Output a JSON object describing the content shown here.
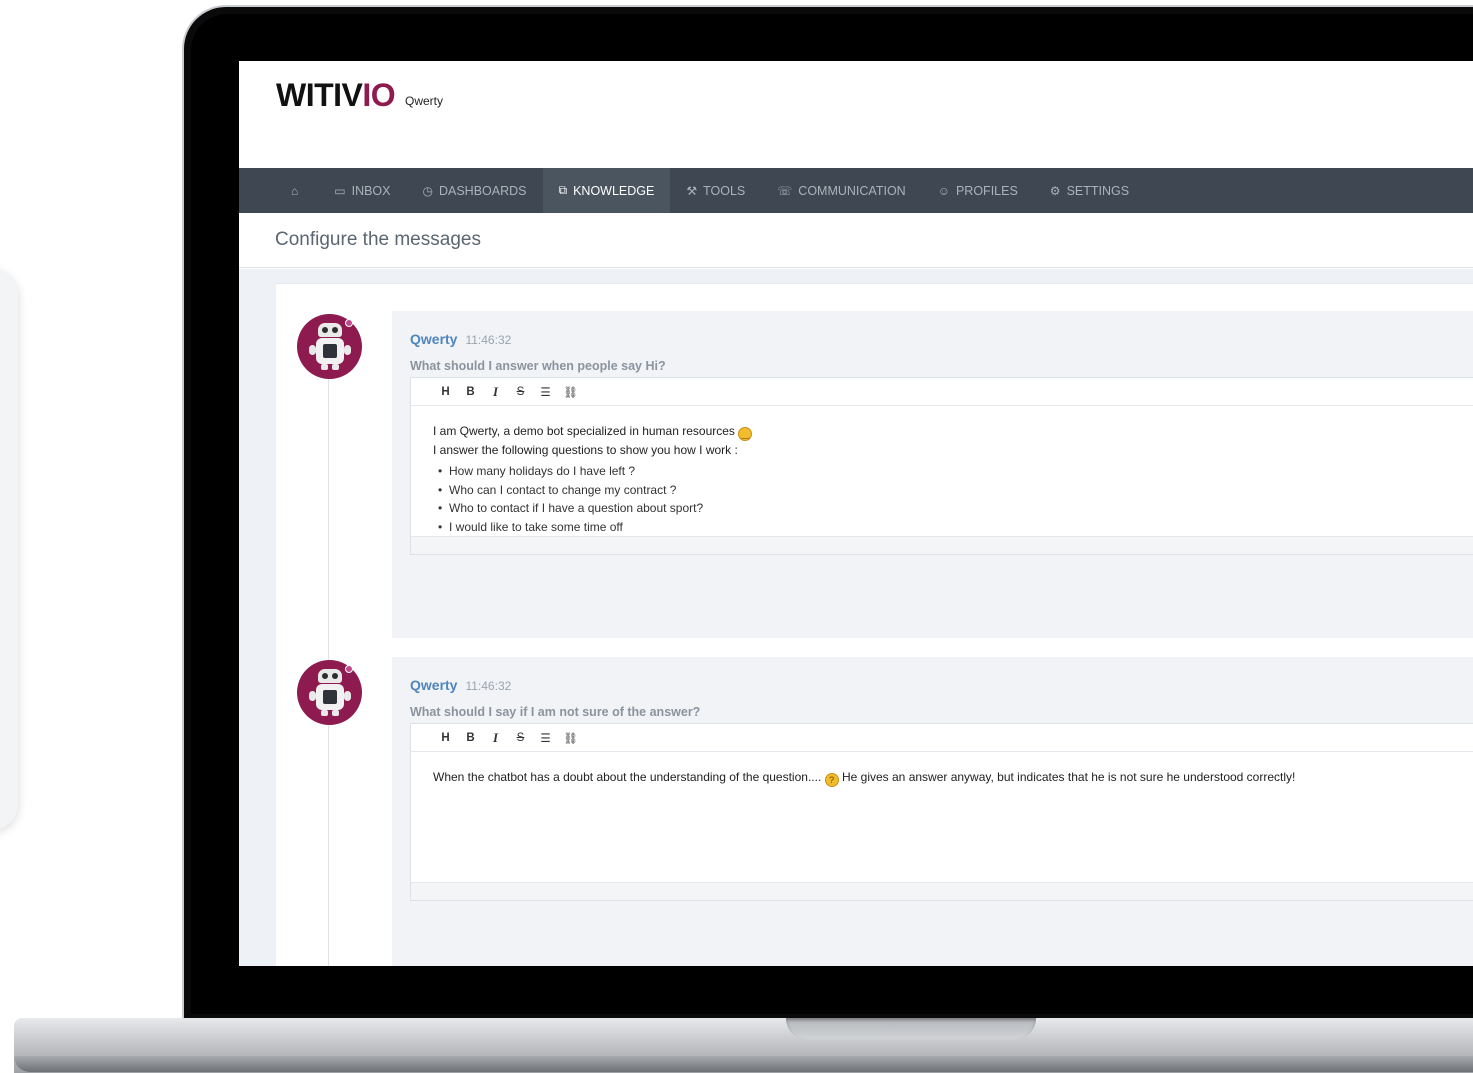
{
  "header": {
    "logo_main": "WITIV",
    "logo_accent": "IO",
    "subtitle": "Qwerty"
  },
  "nav": {
    "items": [
      {
        "label": "",
        "icon": "home-icon"
      },
      {
        "label": "INBOX",
        "icon": "inbox-icon"
      },
      {
        "label": "DASHBOARDS",
        "icon": "clock-icon"
      },
      {
        "label": "KNOWLEDGE",
        "icon": "chat-bubbles-icon",
        "active": true
      },
      {
        "label": "TOOLS",
        "icon": "wrench-icon"
      },
      {
        "label": "COMMUNICATION",
        "icon": "phone-icon"
      },
      {
        "label": "PROFILES",
        "icon": "users-icon"
      },
      {
        "label": "SETTINGS",
        "icon": "gears-icon"
      }
    ]
  },
  "page": {
    "title": "Configure the messages"
  },
  "toolbar": {
    "heading": "H",
    "bold": "B",
    "italic": "I",
    "strike": "S",
    "list": "☰",
    "link": "⛓"
  },
  "messages": [
    {
      "sender": "Qwerty",
      "time": "11:46:32",
      "question": "What should I answer when people say Hi?",
      "line1": "I am Qwerty, a demo bot specialized in human resources",
      "line2": "I answer the following questions to show you how I work :",
      "bullets": [
        "How many holidays do I have left ?",
        "Who can I contact to change my contract ?",
        "Who to contact if I have a question about sport?",
        "I would like to take some time off"
      ]
    },
    {
      "sender": "Qwerty",
      "time": "11:46:32",
      "question": "What should I say if I am not sure of the answer?",
      "text_before": "When the chatbot has a doubt about the understanding of the question....",
      "text_after": "He gives an answer anyway, but indicates that he is not sure he understood correctly!"
    }
  ]
}
